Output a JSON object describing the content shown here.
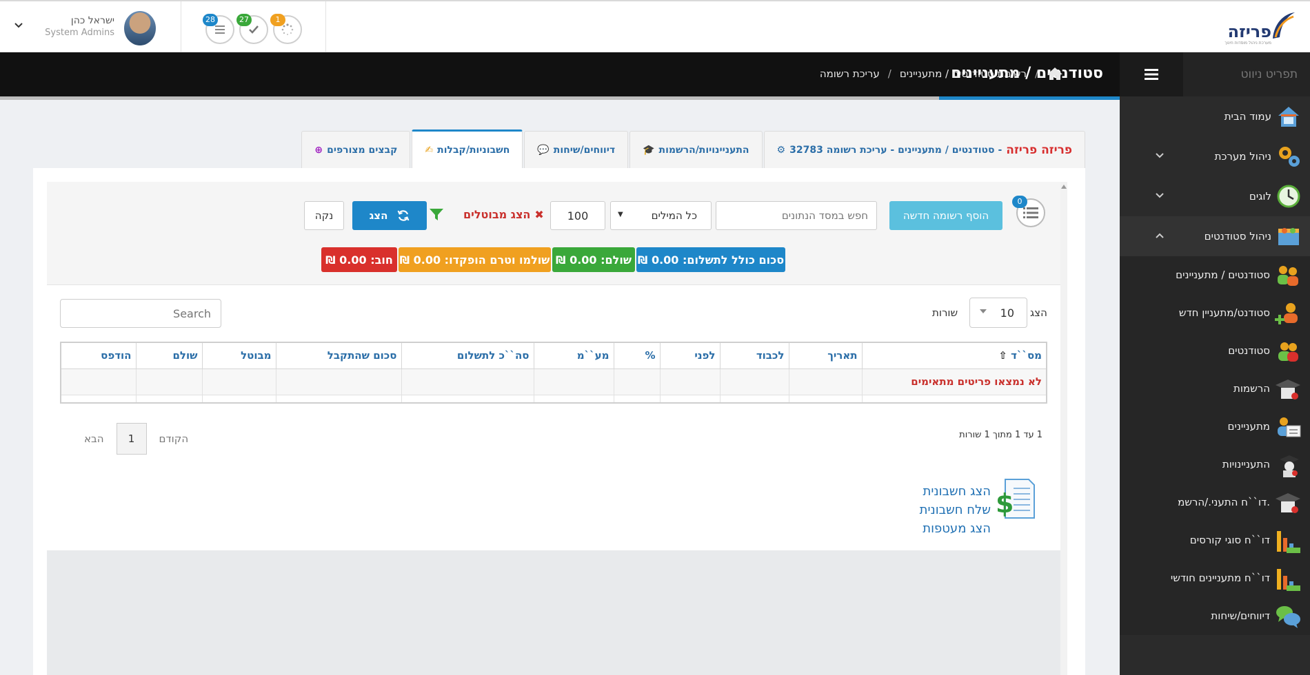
{
  "header": {
    "logo_text": "פריזה",
    "logo_subtext": "מערכת ניהול מוסדות חינוך",
    "user_name": "ישראל כהן",
    "user_role": "System Admins",
    "notifications": [
      {
        "name": "tasks-notification",
        "count": "28",
        "color": "#1e87c9",
        "icon": "list-icon"
      },
      {
        "name": "done-notification",
        "count": "27",
        "color": "#3aa83a",
        "icon": "check-icon"
      },
      {
        "name": "pending-notification",
        "count": "1",
        "color": "#f0a020",
        "icon": "spinner-icon"
      }
    ]
  },
  "titlebar": {
    "page_title": "סטודנטים / מתעניינים",
    "breadcrumb": [
      "רשימת סטודנטים / מתעניינים",
      "עריכת רשומה"
    ]
  },
  "sidebar": {
    "nav_title": "תפריט ניווט",
    "items": [
      {
        "label": "עמוד הבית",
        "icon": "home-icon"
      },
      {
        "label": "ניהול מערכת",
        "icon": "gears-icon",
        "chevron": "down"
      },
      {
        "label": "לוגים",
        "icon": "clock-icon",
        "chevron": "down"
      },
      {
        "label": "ניהול סטודנטים",
        "icon": "students-folder-icon",
        "chevron": "up"
      }
    ],
    "subitems": [
      {
        "label": "סטודנטים / מתעניינים",
        "icon": "people-group-icon"
      },
      {
        "label": "סטודנט/מתעניין חדש",
        "icon": "add-user-icon"
      },
      {
        "label": "סטודנטים",
        "icon": "students-icon"
      },
      {
        "label": "הרשמות",
        "icon": "graduation-cap-icon"
      },
      {
        "label": "מתעניינים",
        "icon": "id-card-icon"
      },
      {
        "label": "התעניינויות",
        "icon": "graduate-icon"
      },
      {
        "label": "דו``ח התעני./הרשמ.",
        "icon": "graduation-report-icon"
      },
      {
        "label": "דו``ח סוגי קורסים",
        "icon": "bar-chart-icon"
      },
      {
        "label": "דו``ח מתעניינים חודשי",
        "icon": "monthly-chart-icon"
      },
      {
        "label": "דיווחים/שיחות",
        "icon": "chat-bubbles-icon"
      }
    ]
  },
  "tabs": [
    {
      "label": "סטודנטים / מתעניינים - עריכת רשומה 32783 -",
      "highlight": "פריזה פריזה",
      "icon": "gears-icon",
      "active": false
    },
    {
      "label": "התעניינויות/הרשמות",
      "icon": "graduate-icon",
      "active": false
    },
    {
      "label": "דיווחים/שיחות",
      "icon": "chat-bubbles-icon",
      "active": false
    },
    {
      "label": "חשבוניות/קבלות",
      "icon": "pen-icon",
      "active": true
    },
    {
      "label": "קבצים מצורפים",
      "icon": "plus-circle-icon",
      "active": false
    }
  ],
  "toolbar": {
    "list_count": "0",
    "add_label": "הוסף רשומה חדשה",
    "search_placeholder": "חפש במסד הנתונים",
    "words_option": "כל המילים",
    "count_value": "100",
    "cancelled_label": "הצג מבוטלים",
    "show_label": "הצג",
    "clear_label": "נקה"
  },
  "totals": [
    {
      "label": "סכום כולל לתשלום: 0.00 ₪",
      "color": "#1e87c9"
    },
    {
      "label": "שולם: 0.00 ₪",
      "color": "#3aa83a"
    },
    {
      "label": "שולמו וטרם הופקדו: 0.00 ₪",
      "color": "#f0a020"
    },
    {
      "label": "חוב: 0.00 ₪",
      "color": "#d9302c"
    }
  ],
  "table": {
    "show_label": "הצג",
    "page_size": "10",
    "rows_label": "שורות",
    "search_placeholder": "Search",
    "columns": [
      "מס``ד",
      "תאריך",
      "לכבוד",
      "לפני",
      "%",
      "מע``מ",
      "סה``כ לתשלום",
      "סכום שהתקבל",
      "מבוטל",
      "שולם",
      "הודפס"
    ],
    "empty_message": "לא נמצאו פריטים מתאימים",
    "summary": "1 עד 1 מתוך 1 שורות",
    "pager": {
      "prev": "הקודם",
      "current": "1",
      "next": "הבא"
    }
  },
  "invoice_links": [
    "הצג חשבונית",
    "שלח חשבונית",
    "הצג מעטפות"
  ]
}
